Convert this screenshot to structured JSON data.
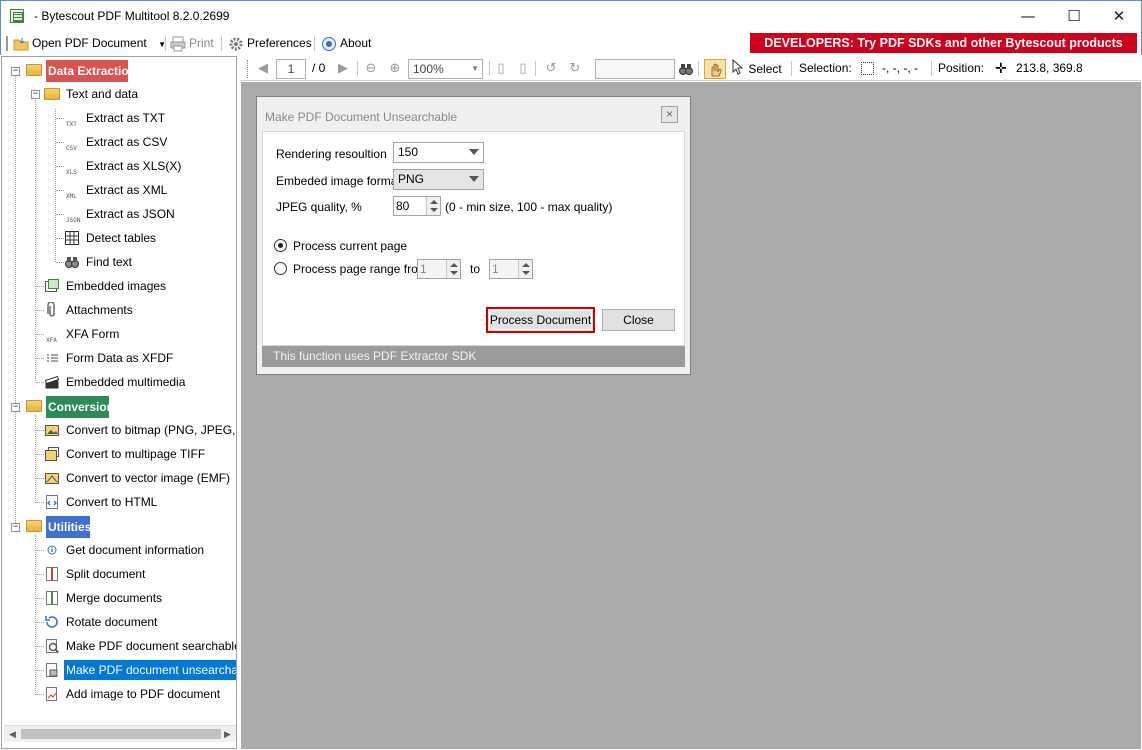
{
  "window": {
    "title": "- Bytescout PDF Multitool 8.2.0.2699",
    "minimize_glyph": "—",
    "maximize_glyph": "☐",
    "close_glyph": "✕"
  },
  "toolbar": {
    "open_label": "Open PDF Document",
    "print_label": "Print",
    "preferences_label": "Preferences",
    "about_label": "About",
    "developers_banner": "DEVELOPERS: Try PDF SDKs and other Bytescout products"
  },
  "viewer_toolbar": {
    "page_value": "1",
    "page_total": "/ 0",
    "zoom_value": "100%",
    "select_label": "Select",
    "selection_label": "Selection:",
    "selection_value": "-, -, -, -",
    "position_label": "Position:",
    "position_value": "213.8, 369.8"
  },
  "tree": {
    "data_extraction": "Data Extraction",
    "text_and_data": "Text and data",
    "extract_txt": "Extract as TXT",
    "extract_csv": "Extract as CSV",
    "extract_xls": "Extract as XLS(X)",
    "extract_xml": "Extract as XML",
    "extract_json": "Extract as JSON",
    "detect_tables": "Detect tables",
    "find_text": "Find text",
    "embedded_images": "Embedded images",
    "attachments": "Attachments",
    "xfa_form": "XFA Form",
    "form_data_xfdf": "Form Data as XFDF",
    "embedded_multimedia": "Embedded multimedia",
    "conversion": "Conversion",
    "convert_bitmap": "Convert to bitmap (PNG, JPEG, ...)",
    "convert_tiff": "Convert to multipage TIFF",
    "convert_vector": "Convert to vector image (EMF)",
    "convert_html": "Convert to HTML",
    "utilities": "Utilities",
    "get_doc_info": "Get document information",
    "split_doc": "Split document",
    "merge_docs": "Merge documents",
    "rotate_doc": "Rotate document",
    "make_searchable": "Make PDF document searchable",
    "make_unsearchable": "Make PDF document unsearchable",
    "add_image": "Add image to PDF document",
    "tags": {
      "txt": "TXT",
      "csv": "CSV",
      "xls": "XLS",
      "xml": "XML",
      "json": "JSON",
      "xfa": "XFA"
    }
  },
  "dialog": {
    "title": "Make PDF Document Unsearchable",
    "rendering_label": "Rendering resoultion",
    "rendering_value": "150",
    "image_format_label": "Embeded image format",
    "image_format_value": "PNG",
    "jpeg_quality_label": "JPEG quality, %",
    "jpeg_quality_value": "80",
    "jpeg_quality_hint": "(0 - min size, 100 - max quality)",
    "process_current_label": "Process current page",
    "process_range_label": "Process page range from",
    "range_from": "1",
    "range_to_label": "to",
    "range_to": "1",
    "process_button": "Process Document",
    "close_button": "Close",
    "status_text": "This function uses PDF Extractor SDK"
  }
}
